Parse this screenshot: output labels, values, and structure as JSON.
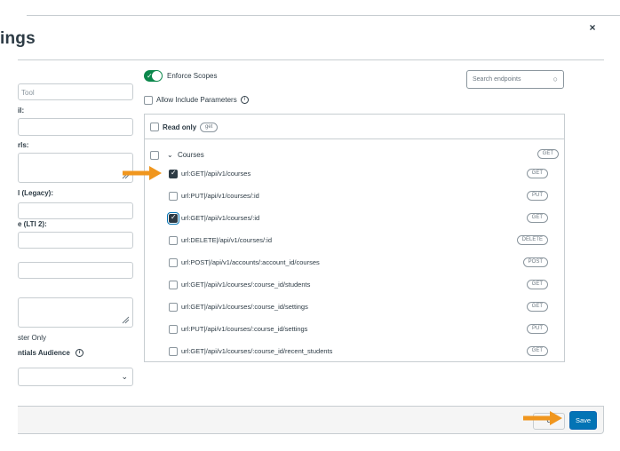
{
  "modal": {
    "title": "ings",
    "close_label": "×"
  },
  "left_form": {
    "tool_placeholder": "Tool",
    "label_email": "il:",
    "label_urls": "rls:",
    "label_legacy": "l (Legacy):",
    "label_lti2": "e (LTI 2):",
    "text_tester_only": "ster Only",
    "label_audience": "ntials Audience"
  },
  "scopes": {
    "enforce_scopes_label": "Enforce Scopes",
    "allow_include_label": "Allow Include Parameters",
    "search_placeholder": "Search endpoints",
    "read_only_label": "Read only",
    "read_only_pill": "get",
    "group": {
      "label": "Courses",
      "pill": "GET"
    },
    "rows": [
      {
        "text": "url:GET|/api/v1/courses",
        "method": "GET",
        "checked": true
      },
      {
        "text": "url:PUT|/api/v1/courses/:id",
        "method": "PUT",
        "checked": false
      },
      {
        "text": "url:GET|/api/v1/courses/:id",
        "method": "GET",
        "checked": true
      },
      {
        "text": "url:DELETE|/api/v1/courses/:id",
        "method": "DELETE",
        "checked": false
      },
      {
        "text": "url:POST|/api/v1/accounts/:account_id/courses",
        "method": "POST",
        "checked": false
      },
      {
        "text": "url:GET|/api/v1/courses/:course_id/students",
        "method": "GET",
        "checked": false
      },
      {
        "text": "url:GET|/api/v1/courses/:course_id/settings",
        "method": "GET",
        "checked": false
      },
      {
        "text": "url:PUT|/api/v1/courses/:course_id/settings",
        "method": "PUT",
        "checked": false
      },
      {
        "text": "url:GET|/api/v1/courses/:course_id/recent_students",
        "method": "GET",
        "checked": false
      }
    ]
  },
  "footer": {
    "cancel_label": "C",
    "save_label": "Save"
  },
  "colors": {
    "toggle_on": "#0b874b",
    "save_button": "#0374b5",
    "annotation_arrow": "#f0961e"
  }
}
